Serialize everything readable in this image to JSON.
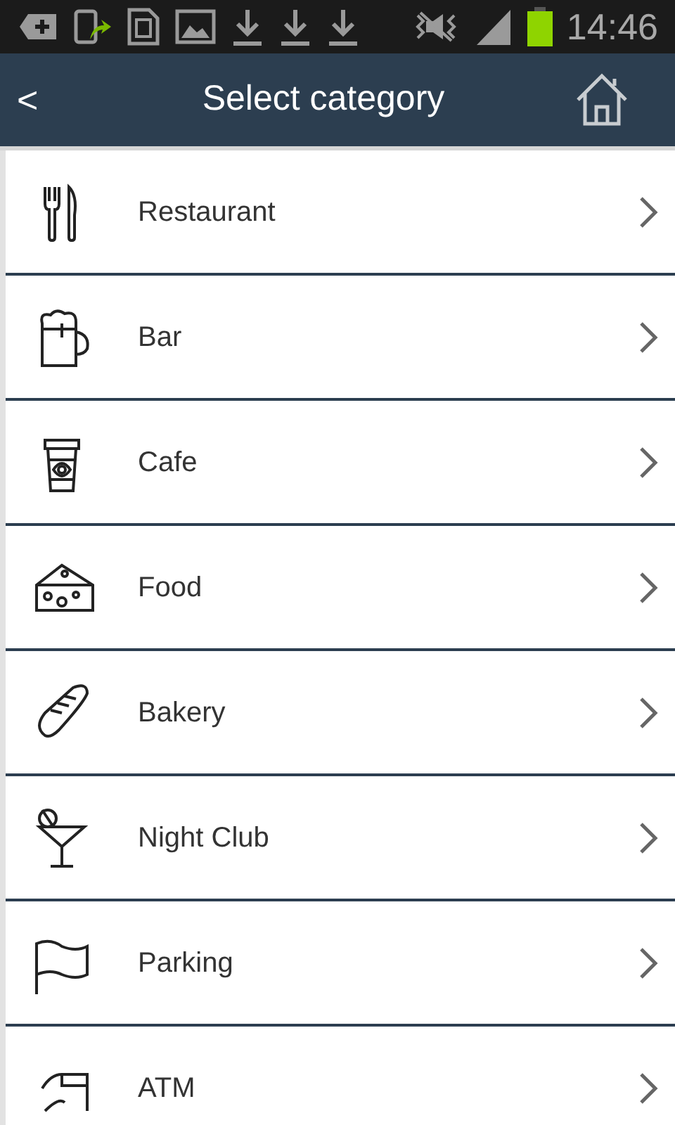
{
  "status_bar": {
    "time": "14:46"
  },
  "header": {
    "title": "Select category",
    "back": "<"
  },
  "categories": [
    {
      "label": "Restaurant",
      "kind": "cutlery"
    },
    {
      "label": "Bar",
      "kind": "beer"
    },
    {
      "label": "Cafe",
      "kind": "cup"
    },
    {
      "label": "Food",
      "kind": "cheese"
    },
    {
      "label": "Bakery",
      "kind": "bread"
    },
    {
      "label": "Night Club",
      "kind": "cocktail"
    },
    {
      "label": "Parking",
      "kind": "flag"
    },
    {
      "label": "ATM",
      "kind": "atm"
    }
  ]
}
